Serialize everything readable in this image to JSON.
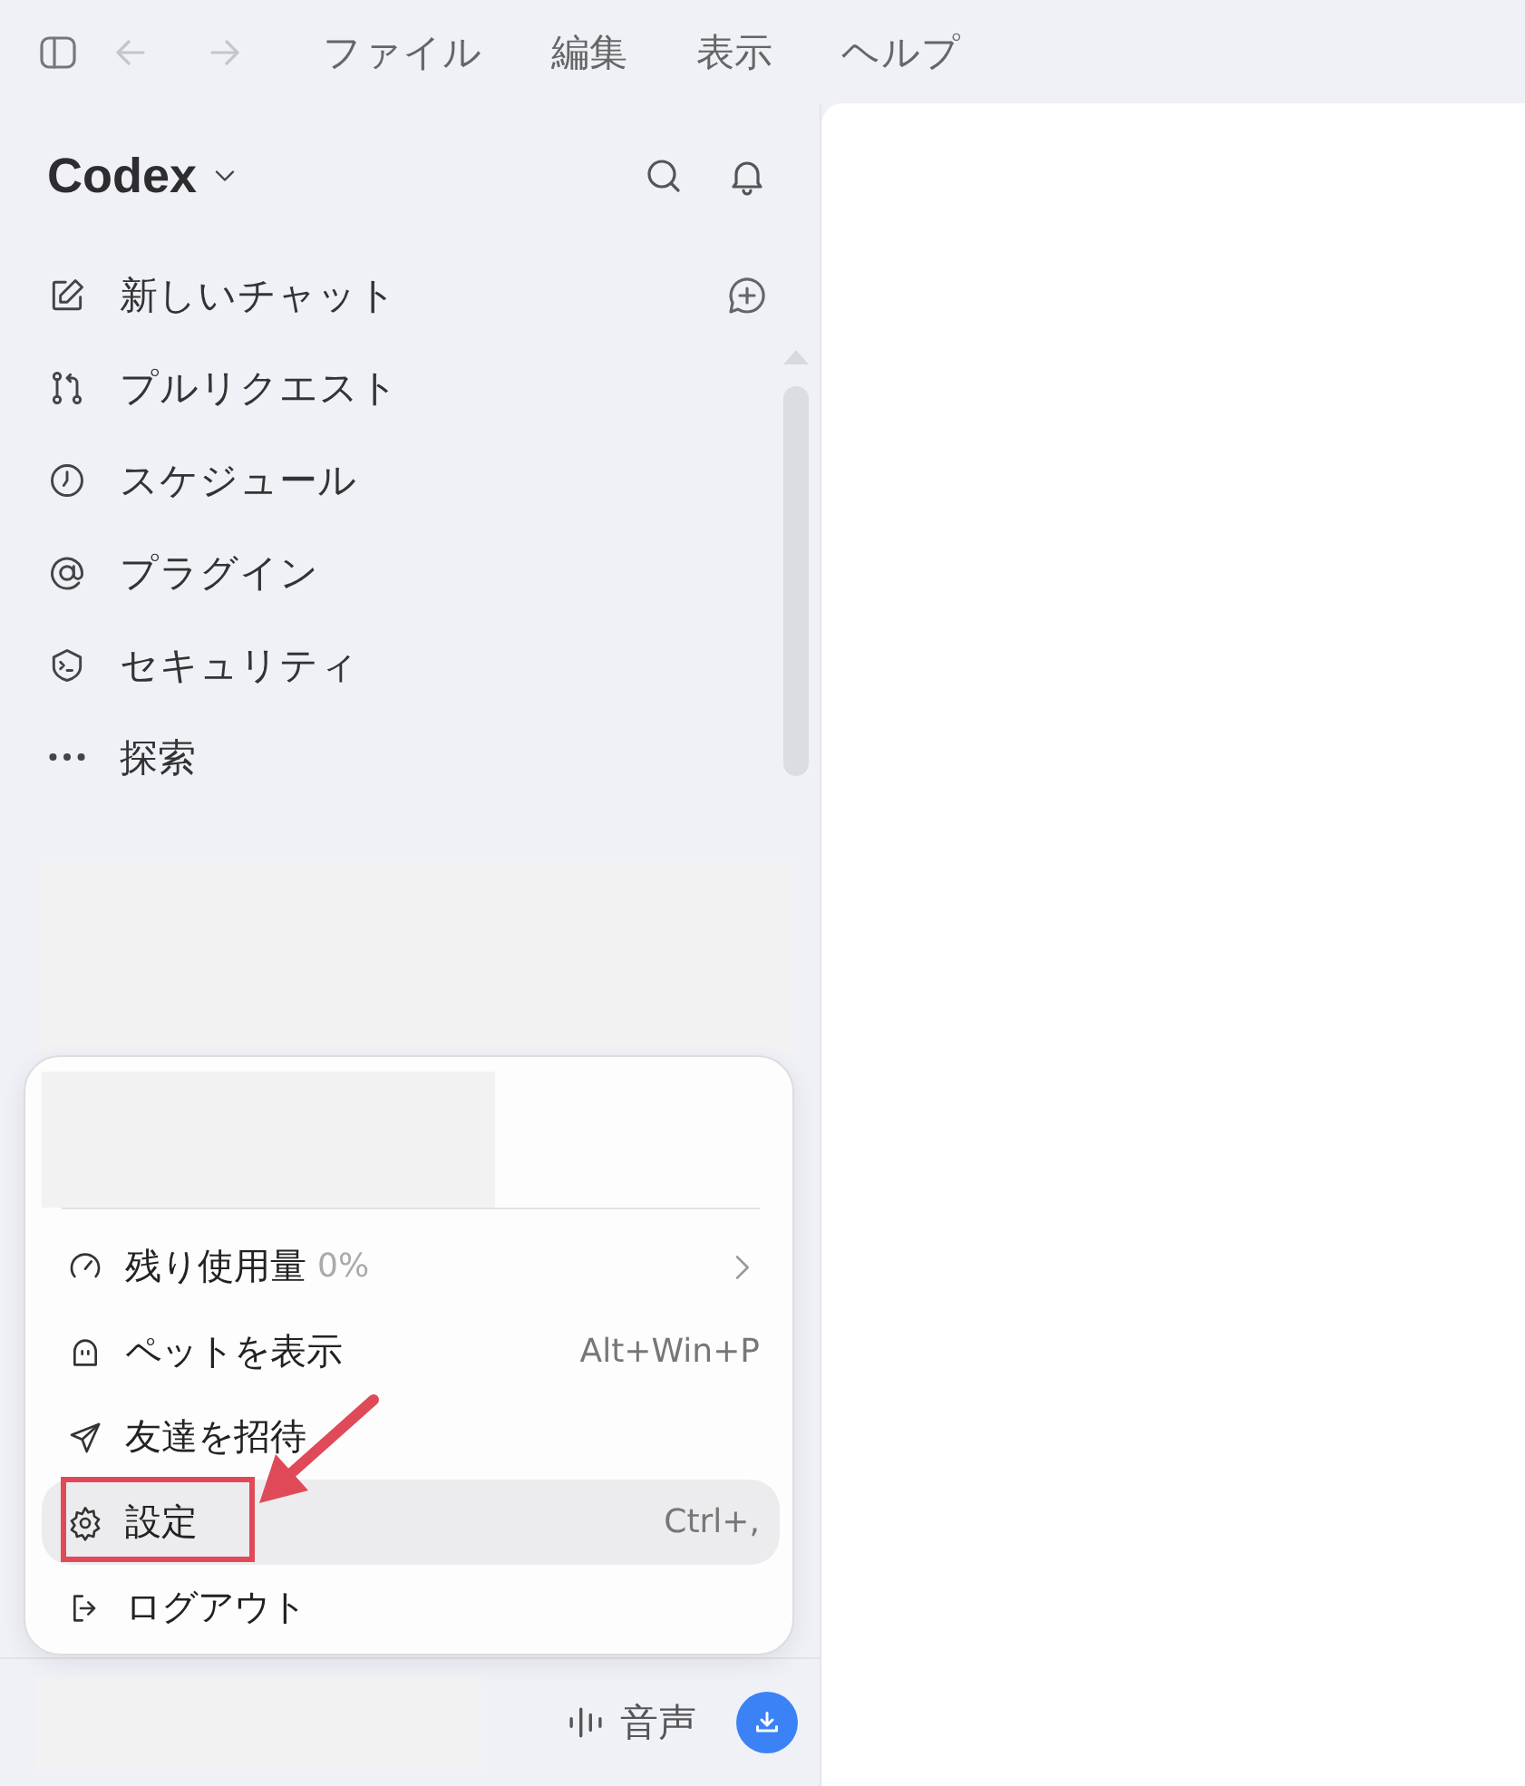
{
  "title_bar": {
    "nav_buttons": [
      {
        "kind": "back",
        "disabled": true
      },
      {
        "kind": "forward",
        "disabled": true
      }
    ],
    "menus": [
      "ファイル",
      "編集",
      "表示",
      "ヘルプ"
    ]
  },
  "sidebar": {
    "title": "Codex",
    "nav": [
      {
        "kind": "new-chat",
        "label": "新しいチャット"
      },
      {
        "kind": "pull-request",
        "label": "プルリクエスト"
      },
      {
        "kind": "schedule",
        "label": "スケジュール"
      },
      {
        "kind": "plugin",
        "label": "プラグイン"
      },
      {
        "kind": "security",
        "label": "セキュリティ"
      },
      {
        "kind": "more",
        "label": "探索"
      }
    ],
    "account_menu": {
      "items": [
        {
          "kind": "usage",
          "label": "残り使用量",
          "detail": "0%",
          "selected": false
        },
        {
          "kind": "pet",
          "label": "ペットを表示",
          "shortcut": "Alt+Win+P",
          "selected": false
        },
        {
          "kind": "invite",
          "label": "友達を招待",
          "selected": false
        },
        {
          "kind": "settings",
          "label": "設定",
          "shortcut": "Ctrl+,",
          "selected": true
        },
        {
          "kind": "logout",
          "label": "ログアウト",
          "selected": false
        }
      ]
    },
    "footer": {
      "voice": "音声"
    }
  }
}
